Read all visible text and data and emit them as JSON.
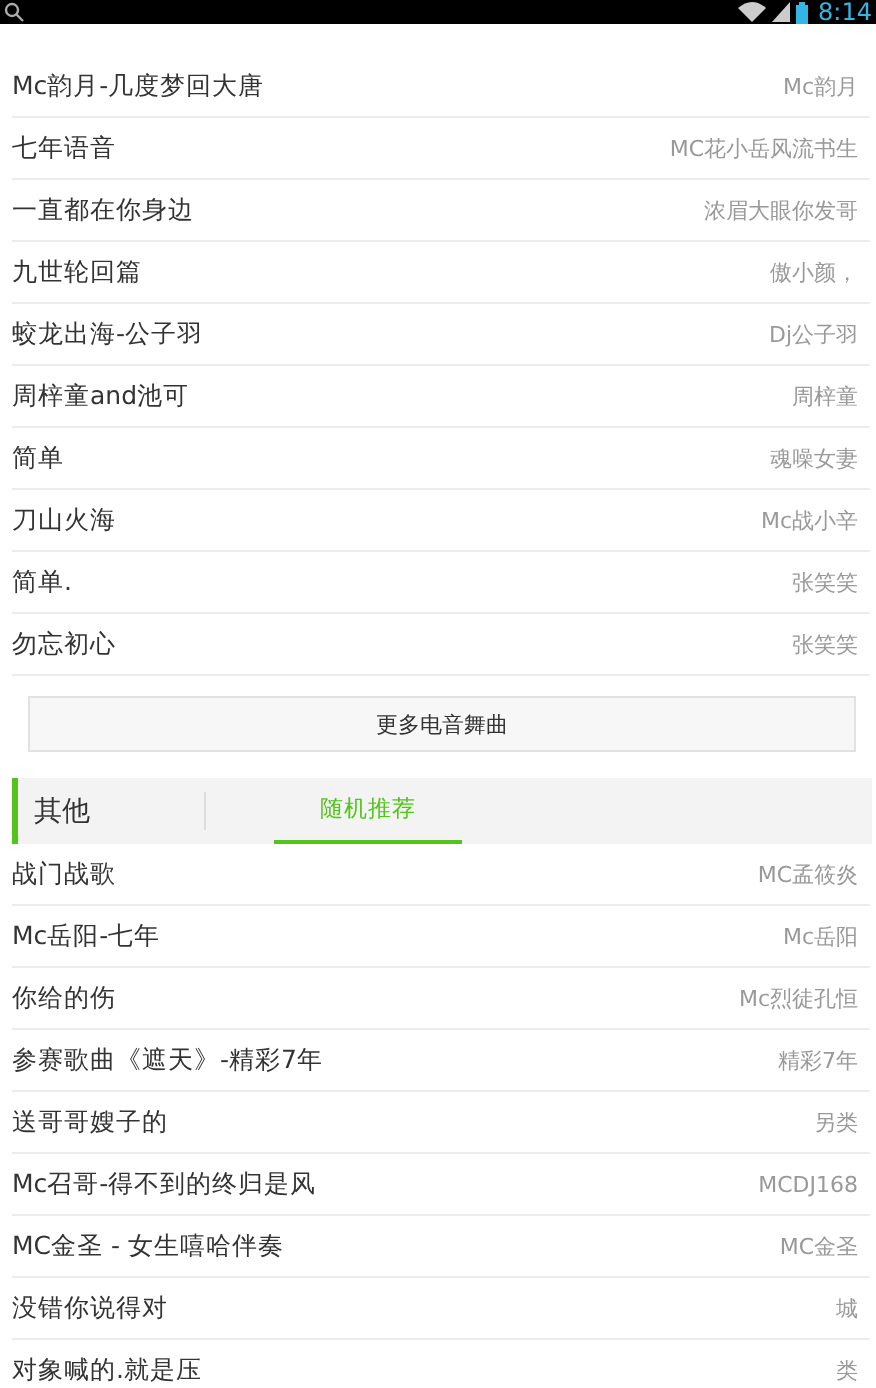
{
  "status_bar": {
    "time": "8:14"
  },
  "top_songs": [
    {
      "title": "Mc韵月-几度梦回大唐",
      "artist": "Mc韵月"
    },
    {
      "title": "七年语音",
      "artist": "MC花小岳风流书生"
    },
    {
      "title": "一直都在你身边",
      "artist": "浓眉大眼你发哥"
    },
    {
      "title": "九世轮回篇",
      "artist": "傲小颜，"
    },
    {
      "title": "蛟龙出海-公子羽",
      "artist": "Dj公子羽"
    },
    {
      "title": "周梓童and池可",
      "artist": "周梓童"
    },
    {
      "title": "简单",
      "artist": "魂噪女妻"
    },
    {
      "title": "刀山火海",
      "artist": "Mc战小辛"
    },
    {
      "title": "简单.",
      "artist": "张笑笑"
    },
    {
      "title": "勿忘初心",
      "artist": "张笑笑"
    }
  ],
  "more_button": "更多电音舞曲",
  "section": {
    "title": "其他",
    "tabs": [
      {
        "label": "随机推荐",
        "selected": true
      }
    ]
  },
  "songs": [
    {
      "title": "战门战歌",
      "artist": "MC孟筱炎"
    },
    {
      "title": "Mc岳阳-七年",
      "artist": "Mc岳阳"
    },
    {
      "title": "你给的伤",
      "artist": "Mc烈徒孔恒"
    },
    {
      "title": "参赛歌曲《遮天》-精彩7年",
      "artist": "精彩7年"
    },
    {
      "title": "送哥哥嫂子的",
      "artist": "另类"
    },
    {
      "title": "Mc召哥-得不到的终归是风",
      "artist": "MCDJ168"
    },
    {
      "title": "MC金圣 - 女生嘻哈伴奏",
      "artist": "MC金圣"
    },
    {
      "title": "没错你说得对",
      "artist": "城"
    },
    {
      "title": "对象喊的.就是压",
      "artist": "类"
    }
  ]
}
